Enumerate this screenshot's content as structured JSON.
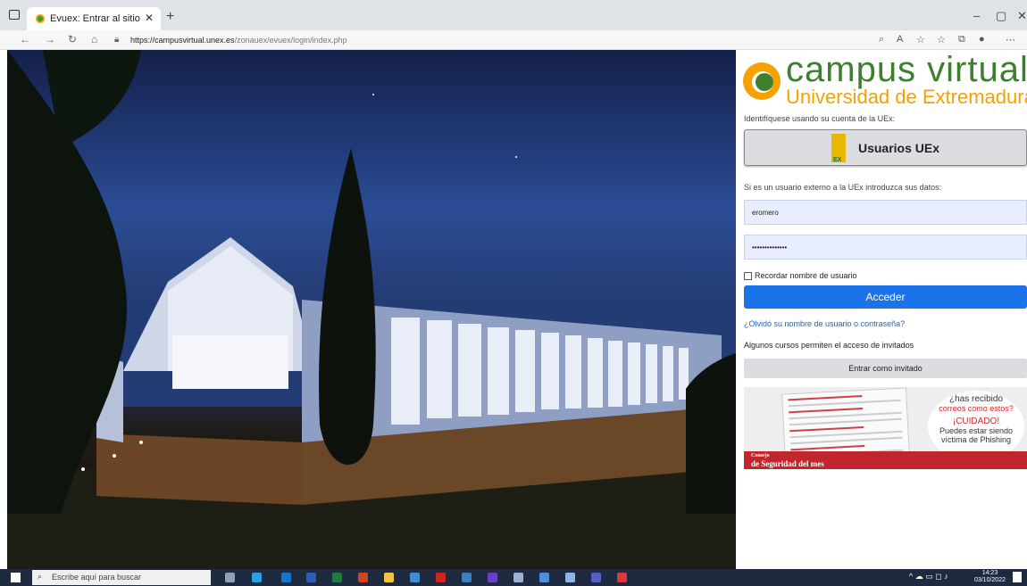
{
  "browser": {
    "tab_title": "Evuex: Entrar al sitio",
    "url_host": "https://campusvirtual.unex.es",
    "url_path": "/zonauex/evuex/login/index.php"
  },
  "logo": {
    "title": "campus virtual",
    "subtitle": "Universidad de Extremadura"
  },
  "login": {
    "uex_prompt": "Identifíquese usando su cuenta de la UEx:",
    "uex_button": "Usuarios UEx",
    "external_prompt": "Si es un usuario externo a la UEx introduzca sus datos:",
    "username_value": "eromero",
    "password_value": "••••••••••••••",
    "remember_label": "Recordar nombre de usuario",
    "submit_label": "Acceder",
    "forgot_link": "¿Olvidó su nombre de usuario o contraseña?",
    "guest_note": "Algunos cursos permiten el acceso de invitados",
    "guest_button": "Entrar como invitado"
  },
  "banner": {
    "line1": "¿has recibido",
    "line2": "correos como estos?",
    "line3": "¡CUIDADO!",
    "line4": "Puedes estar siendo",
    "line5": "víctima de Phishing",
    "strip_small": "Consejo",
    "strip_big": "de Seguridad del mes"
  },
  "taskbar": {
    "search_placeholder": "Escribe aquí para buscar",
    "time": "14:23",
    "date": "03/10/2022"
  }
}
